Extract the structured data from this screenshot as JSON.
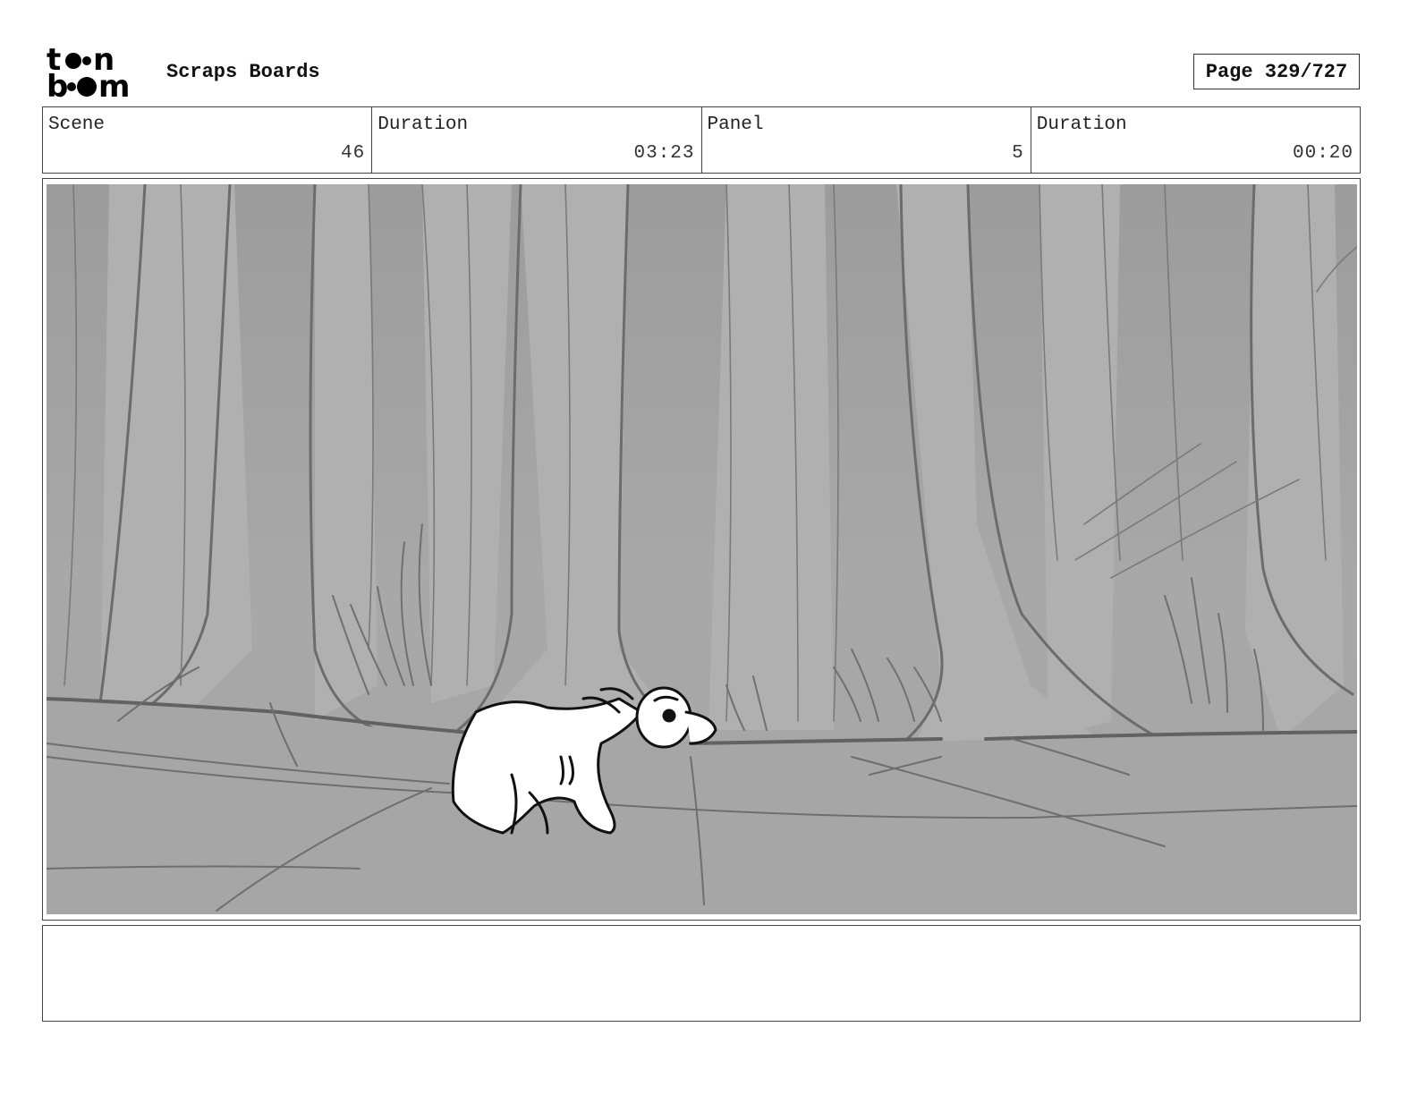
{
  "header": {
    "logo_alt": "toon boom",
    "title": "Scraps Boards",
    "page_label": "Page 329/727"
  },
  "info": {
    "scene_label": "Scene",
    "scene_value": "46",
    "scene_duration_label": "Duration",
    "scene_duration_value": "03:23",
    "panel_label": "Panel",
    "panel_value": "5",
    "panel_duration_label": "Duration",
    "panel_duration_value": "00:20"
  },
  "notes": {
    "text": ""
  },
  "colors": {
    "ink": "#111111",
    "panel_bg": "#a9a9a9",
    "trunk_line": "#6a6a6a",
    "ground": "#a2a2a2"
  }
}
